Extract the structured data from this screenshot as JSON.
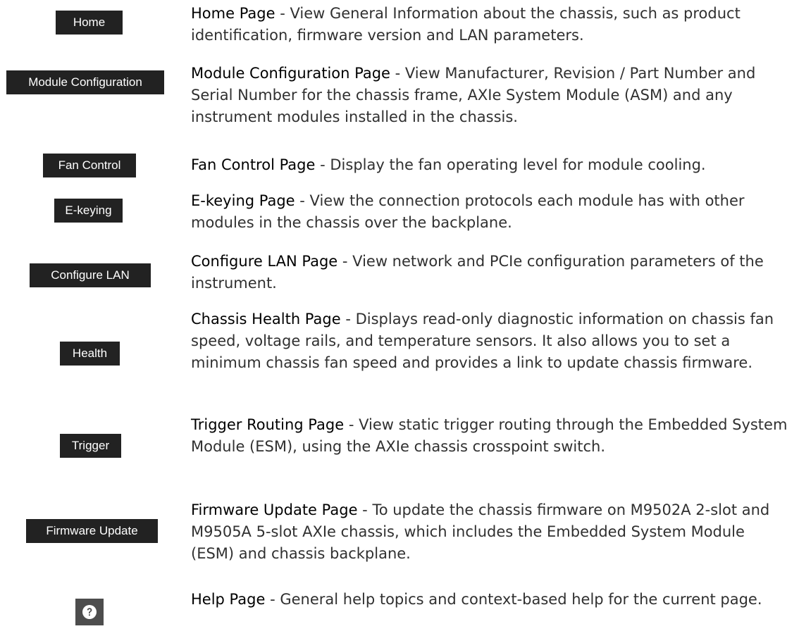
{
  "items": [
    {
      "button_label": "Home",
      "title": "Home Page",
      "separator": " - ",
      "description": "View General Information about the chassis, such as product identification, firmware version and LAN parameters."
    },
    {
      "button_label": "Module Configuration",
      "title": "Module Configuration Page",
      "separator": " - ",
      "description": "View Manufacturer, Revision / Part Number and Serial Number for the chassis frame, AXIe System Module (ASM) and any instrument modules installed in the chassis."
    },
    {
      "button_label": "Fan Control",
      "title": "Fan Control Page",
      "separator": " - ",
      "description": "Display the fan operating level for module cooling."
    },
    {
      "button_label": "E-keying",
      "title": "E-keying Page",
      "separator": " - ",
      "description": "View the connection protocols each module has with other modules in the chassis over the backplane."
    },
    {
      "button_label": "Configure LAN",
      "title": "Configure LAN Page",
      "separator": " - ",
      "description": "View network and PCIe configuration parameters of the instrument."
    },
    {
      "button_label": "Health",
      "title": "Chassis Health Page",
      "separator": " - ",
      "description": "Displays read-only diagnostic information on chassis fan speed, voltage rails, and temperature sensors. It also allows you to set a minimum chassis fan speed and provides a link to update chassis firmware."
    },
    {
      "button_label": "Trigger",
      "title": "Trigger Routing Page",
      "separator": " - ",
      "description": "View static trigger routing through the Embedded System Module (ESM), using the AXIe chassis crosspoint switch."
    },
    {
      "button_label": "Firmware Update",
      "title": "Firmware Update Page",
      "separator": " - ",
      "description": "To update the chassis firmware on M9502A 2-slot and M9505A 5-slot AXIe chassis, which includes the Embedded System Module (ESM) and chassis backplane."
    },
    {
      "button_icon": "help-question-icon",
      "title": "Help Page",
      "separator": " - ",
      "description": "General help topics and context-based help for the current page."
    }
  ],
  "colors": {
    "button_bg": "#222222",
    "button_text": "#ffffff",
    "help_button_bg": "#4d4d4d",
    "body_text": "#303030"
  }
}
